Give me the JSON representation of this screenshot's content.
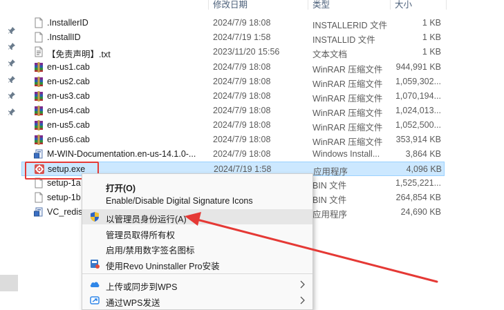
{
  "columns": {
    "date": "修改日期",
    "type": "类型",
    "size": "大小"
  },
  "files": [
    {
      "name": ".InstallerID",
      "date": "2024/7/9 18:08",
      "type": "INSTALLERID 文件",
      "size": "1 KB",
      "icon": "document-icon"
    },
    {
      "name": ".InstallID",
      "date": "2024/7/19 1:58",
      "type": "INSTALLID 文件",
      "size": "1 KB",
      "icon": "document-icon"
    },
    {
      "name": "【免责声明】.txt",
      "date": "2023/11/20 15:56",
      "type": "文本文档",
      "size": "1 KB",
      "icon": "text-document-icon"
    },
    {
      "name": "en-us1.cab",
      "date": "2024/7/9 18:08",
      "type": "WinRAR 压缩文件",
      "size": "944,991 KB",
      "icon": "winrar-archive-icon"
    },
    {
      "name": "en-us2.cab",
      "date": "2024/7/9 18:08",
      "type": "WinRAR 压缩文件",
      "size": "1,059,302...",
      "icon": "winrar-archive-icon"
    },
    {
      "name": "en-us3.cab",
      "date": "2024/7/9 18:08",
      "type": "WinRAR 压缩文件",
      "size": "1,070,194...",
      "icon": "winrar-archive-icon"
    },
    {
      "name": "en-us4.cab",
      "date": "2024/7/9 18:08",
      "type": "WinRAR 压缩文件",
      "size": "1,024,013...",
      "icon": "winrar-archive-icon"
    },
    {
      "name": "en-us5.cab",
      "date": "2024/7/9 18:08",
      "type": "WinRAR 压缩文件",
      "size": "1,052,500...",
      "icon": "winrar-archive-icon"
    },
    {
      "name": "en-us6.cab",
      "date": "2024/7/9 18:08",
      "type": "WinRAR 压缩文件",
      "size": "353,914 KB",
      "icon": "winrar-archive-icon"
    },
    {
      "name": "M-WIN-Documentation.en-us-14.1.0-...",
      "date": "2024/7/9 18:08",
      "type": "Windows Install...",
      "size": "3,864 KB",
      "icon": "installer-package-icon"
    },
    {
      "name": "setup.exe",
      "date": "2024/7/19 1:58",
      "type": "应用程序",
      "size": "4,096 KB",
      "icon": "setup-gear-icon"
    },
    {
      "name": "setup-1a",
      "date": "",
      "type": "BIN 文件",
      "size": "1,525,221...",
      "icon": "document-icon"
    },
    {
      "name": "setup-1b",
      "date": "",
      "type": "BIN 文件",
      "size": "264,854 KB",
      "icon": "document-icon"
    },
    {
      "name": "VC_redis",
      "date": "",
      "type": "应用程序",
      "size": "24,690 KB",
      "icon": "installer-package-icon"
    }
  ],
  "context_menu": {
    "items": [
      {
        "label": "打开(O)",
        "bold": true,
        "icon": ""
      },
      {
        "label": "Enable/Disable Digital Signature Icons",
        "icon": ""
      },
      {
        "label": "以管理员身份运行(A)",
        "icon": "uac-shield-icon",
        "hovered": true
      },
      {
        "label": "管理员取得所有权",
        "icon": ""
      },
      {
        "label": "启用/禁用数字签名图标",
        "icon": ""
      },
      {
        "label": "使用Revo Uninstaller Pro安装",
        "icon": "revo-uninstaller-icon"
      },
      {
        "label": "上传或同步到WPS",
        "icon": "wps-cloud-icon",
        "submenu": true
      },
      {
        "label": "通过WPS发送",
        "icon": "wps-send-icon",
        "submenu": true
      }
    ]
  },
  "colors": {
    "selection_bg": "#cce8ff",
    "annotation_red": "#e53935"
  }
}
